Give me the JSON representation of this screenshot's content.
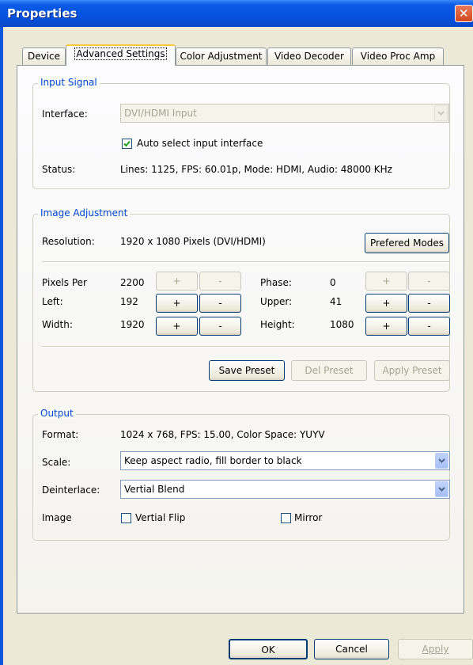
{
  "window": {
    "title": "Properties",
    "close": "✕"
  },
  "tabs": [
    "Device",
    "Advanced Settings",
    "Color Adjustment",
    "Video Decoder",
    "Video Proc Amp"
  ],
  "input_signal": {
    "title": "Input Signal",
    "interface_label": "Interface:",
    "interface_value": "DVI/HDMI Input",
    "auto_select_label": "Auto select input interface",
    "auto_select_checked": true,
    "status_label": "Status:",
    "status_value": "Lines: 1125, FPS: 60.01p, Mode: HDMI, Audio: 48000 KHz"
  },
  "image_adjustment": {
    "title": "Image Adjustment",
    "resolution_label": "Resolution:",
    "resolution_value": "1920 x 1080 Pixels (DVI/HDMI)",
    "prefered_modes": "Prefered Modes",
    "rows": [
      {
        "label": "Pixels Per",
        "value": "2200",
        "right_label": "Phase:",
        "right_value": "0"
      },
      {
        "label": "Left:",
        "value": "192",
        "right_label": "Upper:",
        "right_value": "41"
      },
      {
        "label": "Width:",
        "value": "1920",
        "right_label": "Height:",
        "right_value": "1080"
      }
    ],
    "plus": "+",
    "minus": "-",
    "save_preset": "Save Preset",
    "del_preset": "Del Preset",
    "apply_preset": "Apply Preset"
  },
  "output": {
    "title": "Output",
    "format_label": "Format:",
    "format_value": "1024 x 768, FPS: 15.00, Color Space: YUYV",
    "scale_label": "Scale:",
    "scale_value": "Keep aspect radio, fill border to black",
    "deinterlace_label": "Deinterlace:",
    "deinterlace_value": "Vertial Blend",
    "image_label": "Image",
    "vflip_label": "Vertial Flip",
    "mirror_label": "Mirror"
  },
  "footer": {
    "ok": "OK",
    "cancel": "Cancel",
    "apply": "Apply"
  }
}
